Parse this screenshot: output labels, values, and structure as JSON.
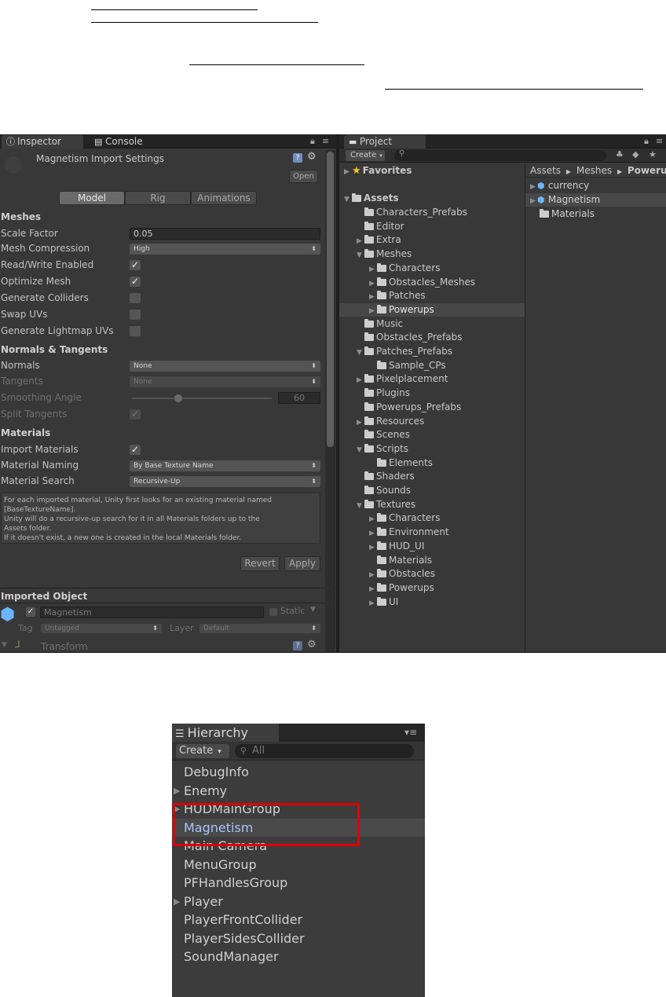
{
  "inspector": {
    "tab_label": "Inspector",
    "console_tab_label": "Console",
    "title": "Magnetism Import Settings",
    "open_label": "Open",
    "tabs": [
      "Model",
      "Rig",
      "Animations"
    ],
    "meshes_header": "Meshes",
    "scale_factor_label": "Scale Factor",
    "scale_factor_value": "0.05",
    "mesh_compression_label": "Mesh Compression",
    "mesh_compression_value": "High",
    "read_write_label": "Read/Write Enabled",
    "optimize_mesh_label": "Optimize Mesh",
    "generate_colliders_label": "Generate Colliders",
    "swap_uvs_label": "Swap UVs",
    "lightmap_uvs_label": "Generate Lightmap UVs",
    "normals_header": "Normals & Tangents",
    "normals_label": "Normals",
    "normals_value": "None",
    "tangents_label": "Tangents",
    "tangents_value": "None",
    "smoothing_label": "Smoothing Angle",
    "smoothing_value": "60",
    "smoothing_slider_fraction": 0.33,
    "split_tangents_label": "Split Tangents",
    "materials_header": "Materials",
    "import_materials_label": "Import Materials",
    "material_naming_label": "Material Naming",
    "material_naming_value": "By Base Texture Name",
    "material_search_label": "Material Search",
    "material_search_value": "Recursive-Up",
    "help_lines": [
      "For each imported material, Unity first looks for an existing material named",
      "[BaseTextureName].",
      "Unity will do a recursive-up search for it in all Materials folders up to the",
      "Assets folder.",
      "If it doesn't exist, a new one is created in the local Materials folder."
    ],
    "revert_label": "Revert",
    "apply_label": "Apply",
    "imported_object_header": "Imported Object",
    "object_name": "Magnetism",
    "static_label": "Static",
    "tag_label": "Tag",
    "tag_value": "Untagged",
    "layer_label": "Layer",
    "layer_value": "Default",
    "transform_label": "Transform"
  },
  "project": {
    "tab_label": "Project",
    "create_label": "Create",
    "favorites_label": "Favorites",
    "assets_label": "Assets",
    "breadcrumb": [
      "Assets",
      "Meshes",
      "Powerups"
    ],
    "tree": [
      {
        "label": "Characters_Prefabs",
        "depth": 1,
        "arrow": false
      },
      {
        "label": "Editor",
        "depth": 1,
        "arrow": false
      },
      {
        "label": "Extra",
        "depth": 1,
        "arrow": true
      },
      {
        "label": "Meshes",
        "depth": 1,
        "arrow": true,
        "open": true
      },
      {
        "label": "Characters",
        "depth": 2,
        "arrow": true
      },
      {
        "label": "Obstacles_Meshes",
        "depth": 2,
        "arrow": true
      },
      {
        "label": "Patches",
        "depth": 2,
        "arrow": true
      },
      {
        "label": "Powerups",
        "depth": 2,
        "arrow": true,
        "selected": true
      },
      {
        "label": "Music",
        "depth": 1,
        "arrow": false
      },
      {
        "label": "Obstacles_Prefabs",
        "depth": 1,
        "arrow": false
      },
      {
        "label": "Patches_Prefabs",
        "depth": 1,
        "arrow": true,
        "open": true
      },
      {
        "label": "Sample_CPs",
        "depth": 2,
        "arrow": false
      },
      {
        "label": "Pixelplacement",
        "depth": 1,
        "arrow": true
      },
      {
        "label": "Plugins",
        "depth": 1,
        "arrow": false
      },
      {
        "label": "Powerups_Prefabs",
        "depth": 1,
        "arrow": false
      },
      {
        "label": "Resources",
        "depth": 1,
        "arrow": true
      },
      {
        "label": "Scenes",
        "depth": 1,
        "arrow": false
      },
      {
        "label": "Scripts",
        "depth": 1,
        "arrow": true,
        "open": true
      },
      {
        "label": "Elements",
        "depth": 2,
        "arrow": false
      },
      {
        "label": "Shaders",
        "depth": 1,
        "arrow": false
      },
      {
        "label": "Sounds",
        "depth": 1,
        "arrow": false
      },
      {
        "label": "Textures",
        "depth": 1,
        "arrow": true,
        "open": true
      },
      {
        "label": "Characters",
        "depth": 2,
        "arrow": true
      },
      {
        "label": "Environment",
        "depth": 2,
        "arrow": true
      },
      {
        "label": "HUD_UI",
        "depth": 2,
        "arrow": true
      },
      {
        "label": "Materials",
        "depth": 2,
        "arrow": false
      },
      {
        "label": "Obstacles",
        "depth": 2,
        "arrow": true
      },
      {
        "label": "Powerups",
        "depth": 2,
        "arrow": true
      },
      {
        "label": "UI",
        "depth": 2,
        "arrow": true
      }
    ],
    "files": [
      {
        "label": "currency",
        "kind": "mesh",
        "selected": false
      },
      {
        "label": "Magnetism",
        "kind": "mesh",
        "selected": true
      },
      {
        "label": "Materials",
        "kind": "folder",
        "selected": false
      }
    ]
  },
  "hierarchy": {
    "tab_label": "Hierarchy",
    "create_label": "Create",
    "search_placeholder": "All",
    "items": [
      {
        "label": "DebugInfo",
        "arrow": false
      },
      {
        "label": "Enemy",
        "arrow": true
      },
      {
        "label": "HUDMainGroup",
        "arrow": true
      },
      {
        "label": "Magnetism",
        "arrow": false,
        "selected": true
      },
      {
        "label": "Main Camera",
        "arrow": false
      },
      {
        "label": "MenuGroup",
        "arrow": false
      },
      {
        "label": "PFHandlesGroup",
        "arrow": false
      },
      {
        "label": "Player",
        "arrow": true
      },
      {
        "label": "PlayerFrontCollider",
        "arrow": false
      },
      {
        "label": "PlayerSidesCollider",
        "arrow": false
      },
      {
        "label": "SoundManager",
        "arrow": false
      }
    ]
  },
  "colors": {
    "panel": "#383838",
    "selection": "#474747",
    "highlight_box": "#e00000",
    "selected_text": "#a8c4ff"
  }
}
